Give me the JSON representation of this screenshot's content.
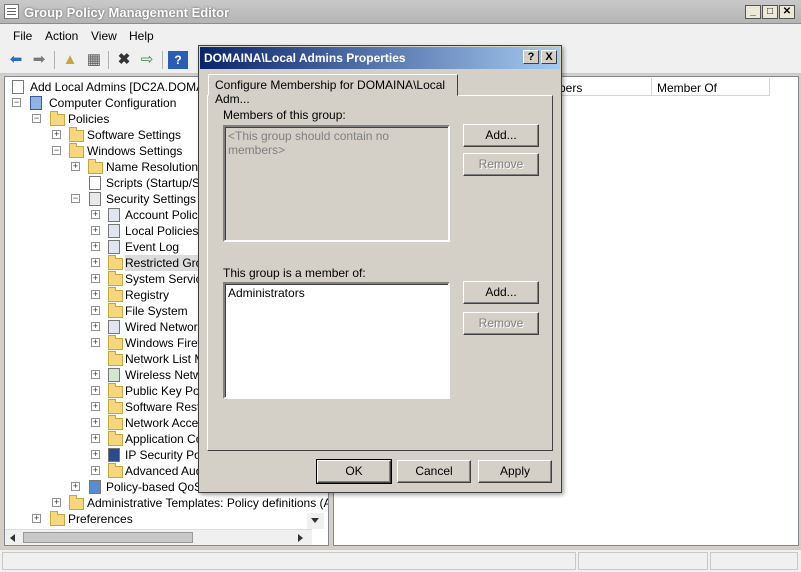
{
  "window": {
    "title": "Group Policy Management Editor"
  },
  "menu": [
    "File",
    "Action",
    "View",
    "Help"
  ],
  "tree": {
    "items": [
      {
        "label": "Add Local Admins [DC2A.DOMAINA",
        "level": 0
      },
      {
        "label": "Computer Configuration",
        "level": 0
      },
      {
        "label": "Policies",
        "level": 1
      },
      {
        "label": "Software Settings",
        "level": 2
      },
      {
        "label": "Windows Settings",
        "level": 2
      },
      {
        "label": "Name Resolution Po",
        "level": 3
      },
      {
        "label": "Scripts (Startup/Shu",
        "level": 3
      },
      {
        "label": "Security Settings",
        "level": 3
      },
      {
        "label": "Account Policies",
        "level": 4
      },
      {
        "label": "Local Policies",
        "level": 4
      },
      {
        "label": "Event Log",
        "level": 4
      },
      {
        "label": "Restricted Grou",
        "level": 4
      },
      {
        "label": "System Service",
        "level": 4
      },
      {
        "label": "Registry",
        "level": 4
      },
      {
        "label": "File System",
        "level": 4
      },
      {
        "label": "Wired Network",
        "level": 4
      },
      {
        "label": "Windows Firewa",
        "level": 4
      },
      {
        "label": "Network List Ma",
        "level": 4
      },
      {
        "label": "Wireless Netwo",
        "level": 4
      },
      {
        "label": "Public Key Polic",
        "level": 4
      },
      {
        "label": "Software Restr",
        "level": 4
      },
      {
        "label": "Network Access",
        "level": 4
      },
      {
        "label": "Application Con",
        "level": 4
      },
      {
        "label": "IP Security Polic",
        "level": 4
      },
      {
        "label": "Advanced Audit",
        "level": 4
      },
      {
        "label": "Policy-based QoS",
        "level": 3
      },
      {
        "label": "Administrative Templates: Policy definitions (AI",
        "level": 2
      },
      {
        "label": "Preferences",
        "level": 1
      }
    ]
  },
  "list": {
    "columns": [
      "bers",
      "Member Of"
    ]
  },
  "dialog": {
    "title": "DOMAINA\\Local Admins Properties",
    "help_label": "?",
    "close_label": "X",
    "tab": "Configure Membership for DOMAINA\\Local Adm...",
    "members_label": "Members of this group:",
    "members_empty": "<This group should contain no members>",
    "memberof_label": "This group is a member of:",
    "memberof_items": [
      "Administrators"
    ],
    "add_label": "Add...",
    "remove_label": "Remove",
    "ok_label": "OK",
    "cancel_label": "Cancel",
    "apply_label": "Apply"
  }
}
